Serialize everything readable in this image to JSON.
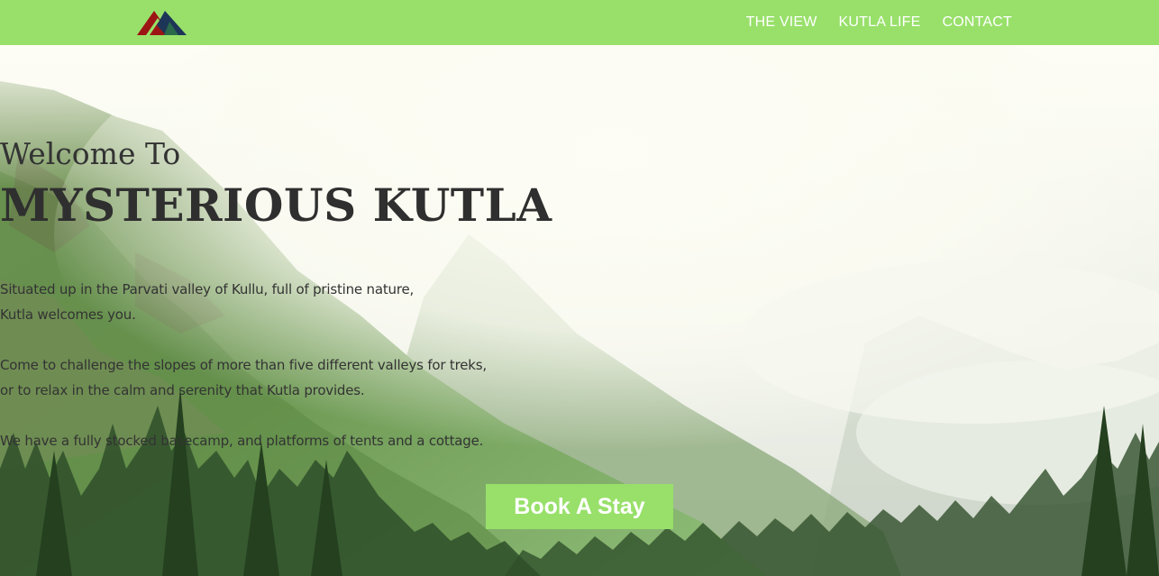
{
  "nav": {
    "logo_name": "mountain-logo",
    "links": [
      "THE VIEW",
      "KUTLA LIFE",
      "CONTACT"
    ]
  },
  "hero": {
    "welcome": "Welcome To",
    "title": "MYSTERIOUS KUTLA",
    "paragraph1": [
      "Situated up in the Parvati valley of Kullu, full of pristine nature,",
      "Kutla welcomes you."
    ],
    "paragraph2": [
      "Come to challenge the slopes of more than five different valleys for treks,",
      "or to relax in the calm and serenity that Kutla provides."
    ],
    "paragraph3": [
      "We have a fully stocked basecamp, and platforms of tents and a cottage."
    ],
    "button": "Book A Stay"
  },
  "colors": {
    "accent": "#98e06a",
    "logo_red": "#9c1414",
    "logo_navy": "#1d3557",
    "text": "#333333"
  }
}
